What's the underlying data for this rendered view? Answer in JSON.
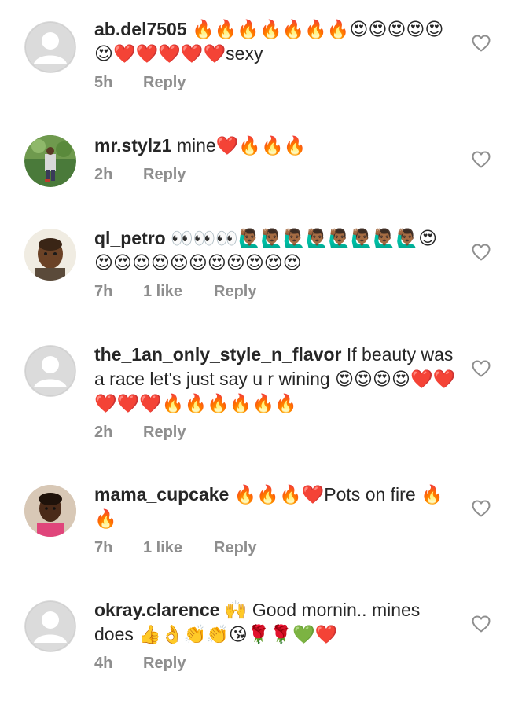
{
  "comments": [
    {
      "username": "ab.del7505",
      "text": " 🔥🔥🔥🔥🔥🔥🔥😍😍😍😍😍😍❤️❤️❤️❤️❤️sexy",
      "time": "5h",
      "likes": "",
      "reply": "Reply",
      "avatar": "default-avatar-icon"
    },
    {
      "username": "mr.stylz1",
      "text": " mine❤️🔥🔥🔥",
      "time": "2h",
      "likes": "",
      "reply": "Reply",
      "avatar": "photo"
    },
    {
      "username": "ql_petro",
      "text": " 👀👀👀🙋🏾‍♂️🙋🏾‍♂️🙋🏾‍♂️🙋🏾‍♂️🙋🏾‍♂️🙋🏾‍♂️🙋🏾‍♂️🙋🏾‍♂️😍😍😍😍😍😍😍😍😍😍😍😍",
      "time": "7h",
      "likes": "1 like",
      "reply": "Reply",
      "avatar": "photo"
    },
    {
      "username": "the_1an_only_style_n_flavor",
      "text": " If beauty was a race let's just say u r wining 😍😍😍😍❤️❤️❤️❤️❤️🔥🔥🔥🔥🔥🔥",
      "time": "2h",
      "likes": "",
      "reply": "Reply",
      "avatar": "default-avatar-icon"
    },
    {
      "username": "mama_cupcake",
      "text": " 🔥🔥🔥❤️Pots on fire 🔥🔥",
      "time": "7h",
      "likes": "1 like",
      "reply": "Reply",
      "avatar": "photo"
    },
    {
      "username": "okray.clarence",
      "text": " 🙌 Good mornin.. mines does 👍👌👏👏😘🌹🌹💚❤️",
      "time": "4h",
      "likes": "",
      "reply": "Reply",
      "avatar": "default-avatar-icon"
    }
  ],
  "colors": {
    "text": "#262626",
    "meta": "#8e8e8e",
    "heart_outline": "#8e8e8e",
    "avatar_bg": "#dbdbdb"
  }
}
